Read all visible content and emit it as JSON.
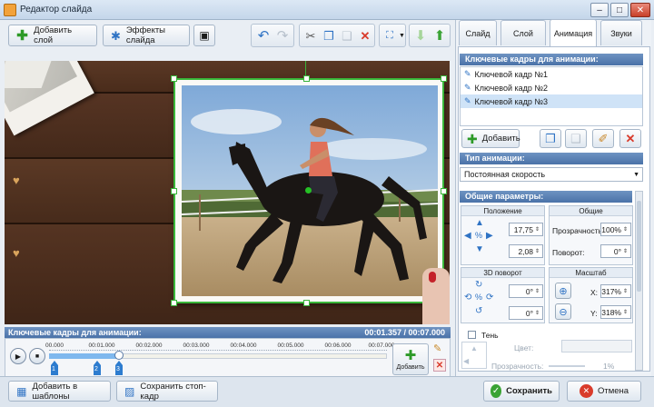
{
  "window": {
    "title": "Редактор слайда"
  },
  "toolbar": {
    "add_layer_label": "Добавить слой",
    "slide_effects_label": "Эффекты слайда"
  },
  "tabs": [
    {
      "label": "Слайд"
    },
    {
      "label": "Слой"
    },
    {
      "label": "Анимация"
    },
    {
      "label": "Звуки"
    }
  ],
  "animation": {
    "keyframes_title": "Ключевые кадры для анимации:",
    "keyframes": [
      {
        "label": "Ключевой кадр №1"
      },
      {
        "label": "Ключевой кадр №2"
      },
      {
        "label": "Ключевой кадр №3"
      }
    ],
    "add_label": "Добавить",
    "anim_type_title": "Тип анимации:",
    "anim_type_value": "Постоянная скорость",
    "general_title": "Общие параметры:",
    "position": {
      "title": "Положение",
      "x": "17,75",
      "y": "2,08"
    },
    "common": {
      "title": "Общие",
      "opacity_label": "Прозрачность:",
      "opacity_value": "100%",
      "rotation_label": "Поворот:",
      "rotation_value": "0°"
    },
    "rotation3d": {
      "title": "3D поворот",
      "a": "0°",
      "b": "0°"
    },
    "scale": {
      "title": "Масштаб",
      "x_label": "X:",
      "x_value": "317%",
      "y_label": "Y:",
      "y_value": "318%"
    },
    "shadow": {
      "label": "Тень",
      "color_label": "Цвет:",
      "opacity_label": "Прозрачность:",
      "opacity_value": "1%"
    }
  },
  "timeline": {
    "title": "Ключевые кадры для анимации:",
    "time": "00:01.357 / 00:07.000",
    "ticks": [
      "00.000",
      "00:01.000",
      "00:02.000",
      "00:03.000",
      "00:04.000",
      "00:05.000",
      "00:06.000",
      "00:07.000"
    ],
    "markers": [
      "1",
      "2",
      "3"
    ],
    "add_label": "Добавить"
  },
  "bottom": {
    "add_template_label": "Добавить в шаблоны",
    "save_frame_label": "Сохранить стоп-кадр",
    "save_label": "Сохранить",
    "cancel_label": "Отмена"
  }
}
